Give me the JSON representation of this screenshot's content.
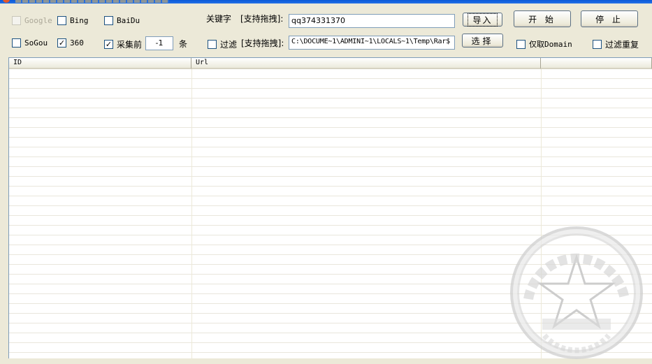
{
  "engines": {
    "google": {
      "label": "Google",
      "checked": false,
      "disabled": true
    },
    "bing": {
      "label": "Bing",
      "checked": false
    },
    "baidu": {
      "label": "BaiDu",
      "checked": false
    },
    "sogou": {
      "label": "SoGou",
      "checked": false
    },
    "s360": {
      "label": "360",
      "checked": true
    }
  },
  "collect": {
    "label": "采集前",
    "checked": true,
    "count": "-1",
    "unit": "条"
  },
  "keyword": {
    "label": "关键字",
    "hint": "[支持拖拽]:",
    "value": "qq374331370",
    "import_label": "导入"
  },
  "filter": {
    "label": "过滤",
    "hint": "[支持拖拽]:",
    "checked": false,
    "path": "C:\\DOCUME~1\\ADMINI~1\\LOCALS~1\\Temp\\Rar$",
    "select_label": "选择"
  },
  "options": {
    "domain_only": {
      "label": "仅取Domain",
      "checked": false
    },
    "dedupe": {
      "label": "过滤重复",
      "checked": false
    }
  },
  "controls": {
    "start_label": "开 始",
    "stop_label": "停 止"
  },
  "list": {
    "columns": [
      "ID",
      "Url",
      ""
    ],
    "rows": []
  },
  "colors": {
    "window_bg": "#ece9d8",
    "input_border": "#7f9db9",
    "titlebar": "#0a5ad8"
  },
  "checkmark": "✓"
}
